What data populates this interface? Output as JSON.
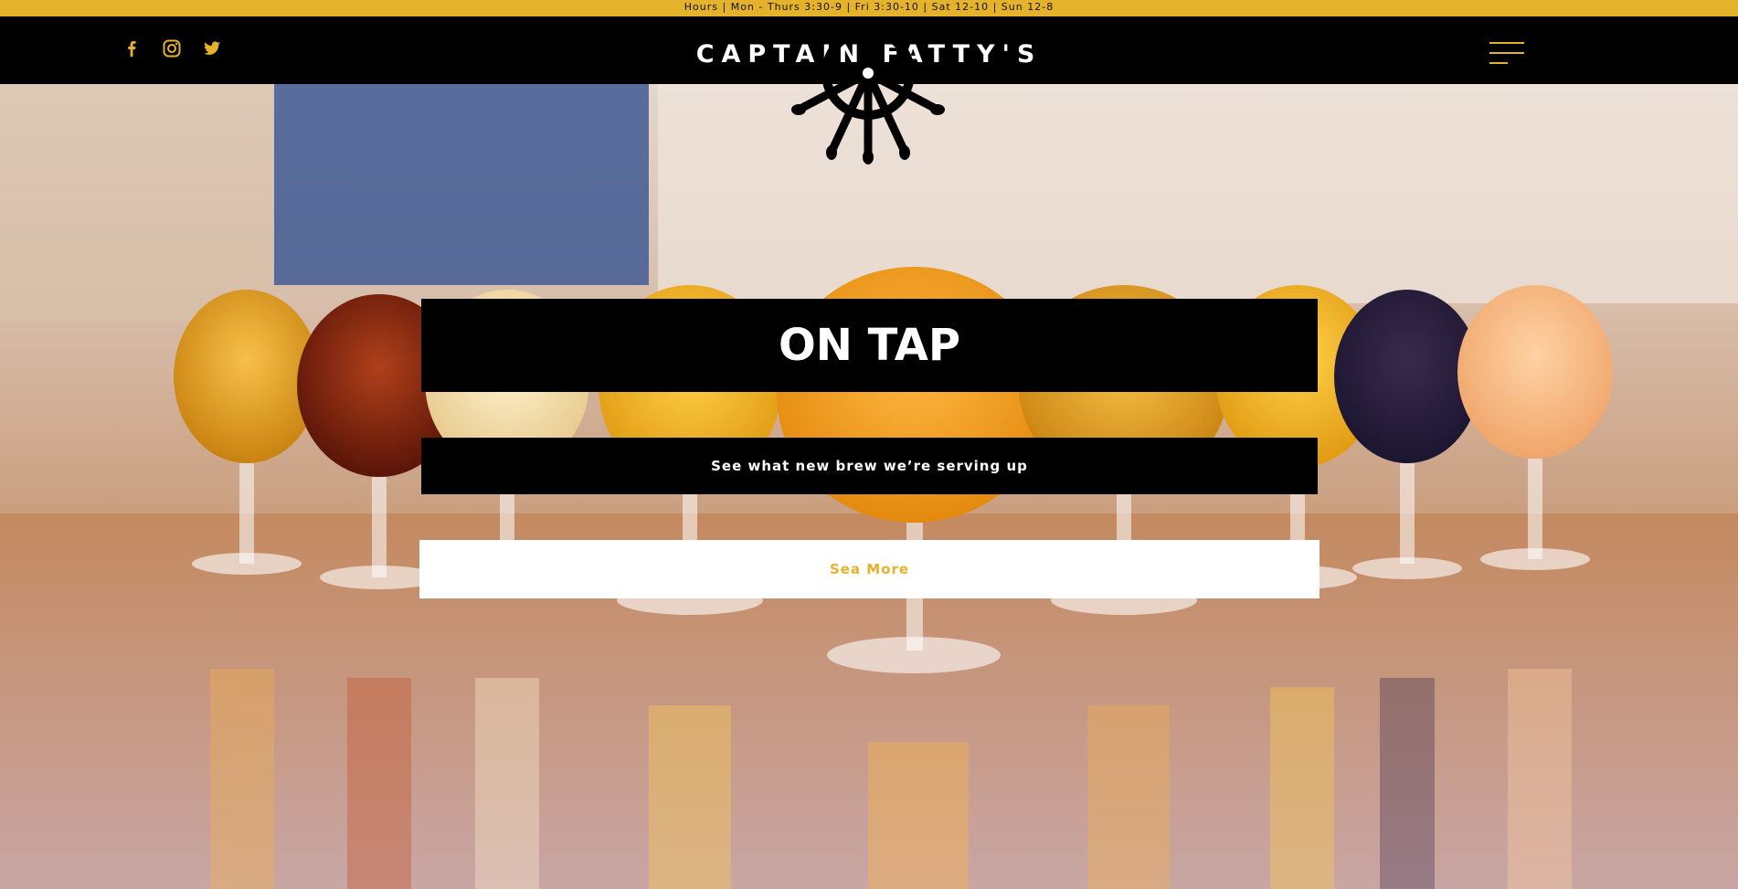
{
  "topbar": {
    "hours_text": "Hours | Mon - Thurs 3:30-9 | Fri 3:30-10 | Sat 12-10 | Sun 12-8"
  },
  "header": {
    "brand": "CAPTAIN FATTY'S",
    "social_icons": [
      "facebook-icon",
      "instagram-icon",
      "twitter-icon"
    ],
    "menu_icon": "hamburger-menu-icon"
  },
  "hero": {
    "title": "ON TAP",
    "subtitle": "See what new brew we’re serving up",
    "cta_label": "Sea More",
    "logo_icon": "ship-wheel-icon"
  },
  "colors": {
    "accent": "#e5b22b",
    "header_bg": "#000000",
    "text_light": "#ffffff"
  }
}
